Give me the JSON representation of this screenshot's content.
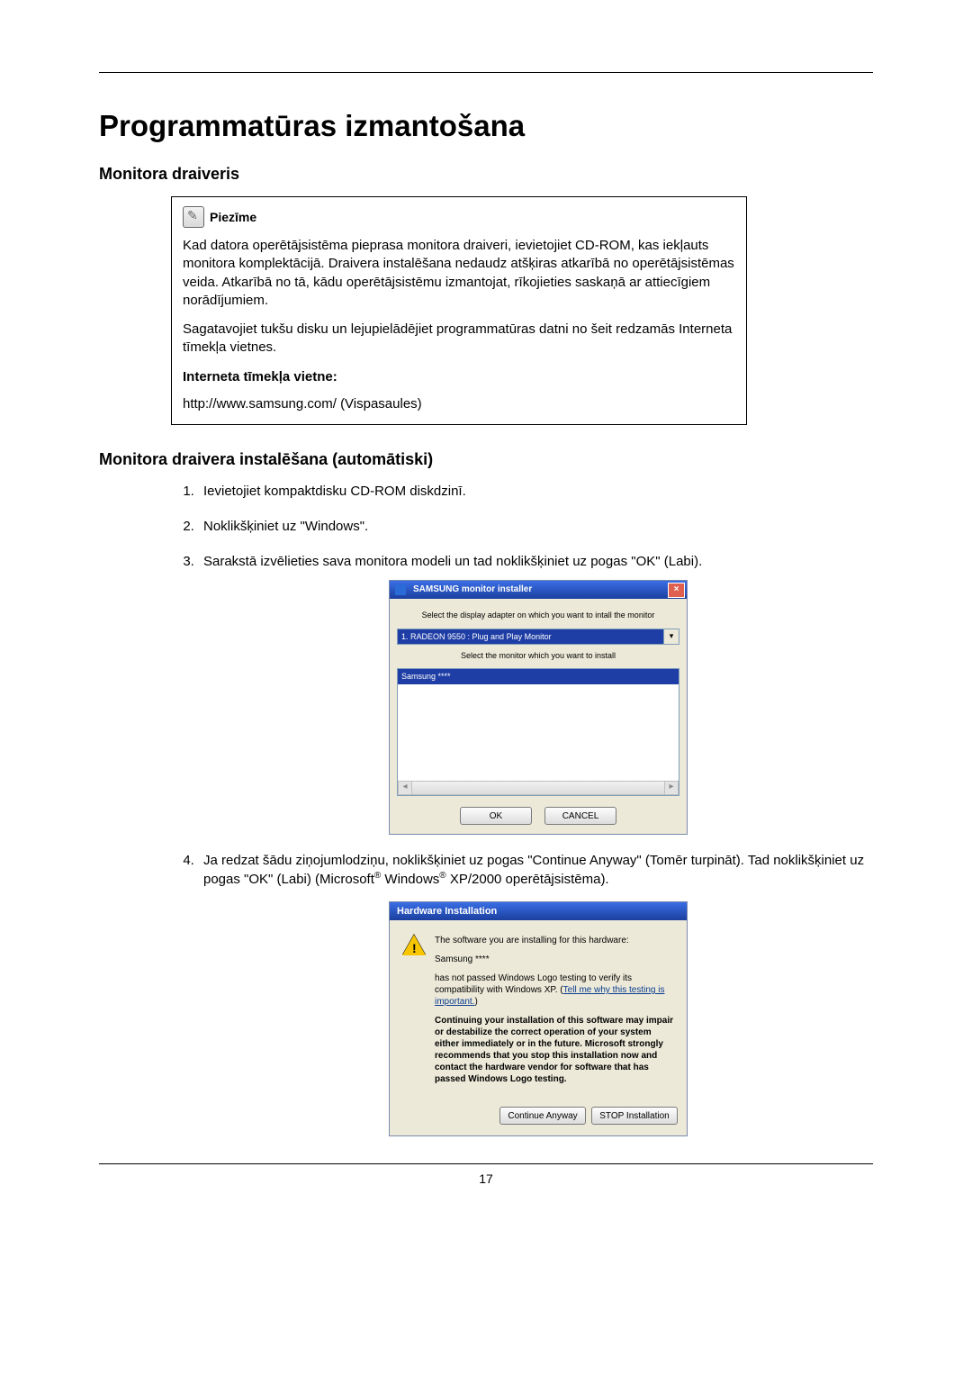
{
  "page": {
    "number": "17",
    "title": "Programmatūras izmantošana",
    "section1": "Monitora draiveris",
    "section2": "Monitora draivera instalēšana (automātiski)"
  },
  "note": {
    "label": "Piezīme",
    "p1": "Kad datora operētājsistēma pieprasa monitora draiveri, ievietojiet CD-ROM, kas iekļauts monitora komplektācijā. Draivera instalēšana nedaudz atšķiras atkarībā no operētājsistēmas veida. Atkarībā no tā, kādu operētājsistēmu izmantojat, rīkojieties saskaņā ar attiecīgiem norādījumiem.",
    "p2": "Sagatavojiet tukšu disku un lejupielādējiet programmatūras datni no šeit redzamās Interneta tīmekļa vietnes.",
    "site_label": "Interneta tīmekļa vietne:",
    "url": "http://www.samsung.com/ (Vispasaules)"
  },
  "steps": {
    "s1": "Ievietojiet kompaktdisku CD-ROM diskdzinī.",
    "s2": "Noklikšķiniet uz \"Windows\".",
    "s3": "Sarakstā izvēlieties sava monitora modeli un tad noklikšķiniet uz pogas \"OK\" (Labi).",
    "s4a": "Ja redzat šādu ziņojumlodziņu, noklikšķiniet uz pogas \"Continue Anyway\" (Tomēr turpināt). Tad noklikšķiniet uz pogas \"OK\" (Labi) (Microsoft",
    "s4b": " Windows",
    "s4c": " XP/2000 operētājsistēma)."
  },
  "win1": {
    "title": "SAMSUNG monitor installer",
    "line1": "Select the display adapter on which you want to intall the monitor",
    "adapter": "1. RADEON 9550 : Plug and Play Monitor",
    "line2": "Select the monitor which you want to install",
    "model": "Samsung ****",
    "ok": "OK",
    "cancel": "CANCEL"
  },
  "win2": {
    "title": "Hardware Installation",
    "l1": "The software you are installing for this hardware:",
    "l2": "Samsung ****",
    "l3a": "has not passed Windows Logo testing to verify its compatibility with Windows XP. (",
    "l3link": "Tell me why this testing is important.",
    "l3b": ")",
    "l4": "Continuing your installation of this software may impair or destabilize the correct operation of your system either immediately or in the future. Microsoft strongly recommends that you stop this installation now and contact the hardware vendor for software that has passed Windows Logo testing.",
    "btn_continue": "Continue Anyway",
    "btn_stop": "STOP Installation"
  }
}
